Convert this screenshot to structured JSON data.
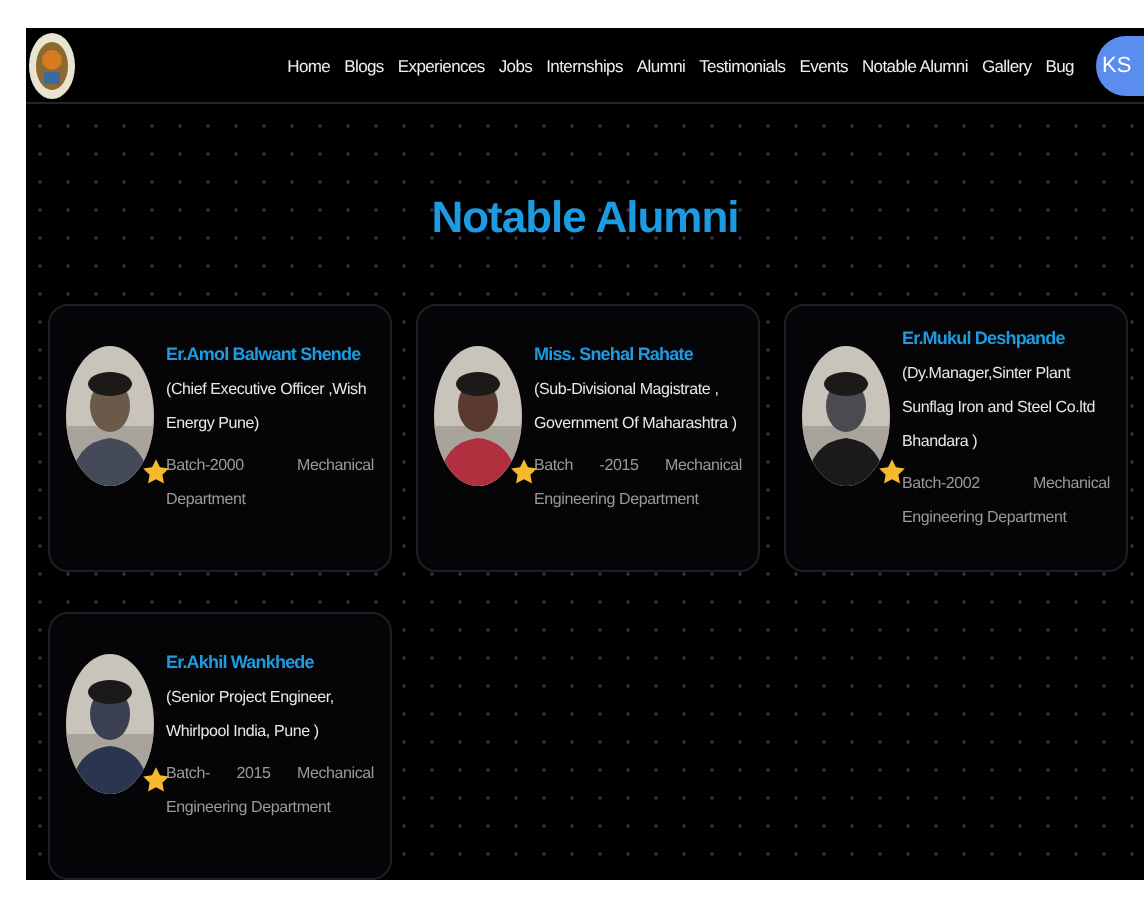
{
  "nav": {
    "items": [
      "Home",
      "Blogs",
      "Experiences",
      "Jobs",
      "Internships",
      "Alumni",
      "Testimonials",
      "Events",
      "Notable Alumni",
      "Gallery",
      "Bug"
    ],
    "avatar": "KS"
  },
  "heading": "Notable Alumni",
  "alumni": [
    {
      "name": "Er.Amol Balwant Shende",
      "role": "(Chief Executive Officer ,Wish Energy Pune)",
      "batch": "Batch-2000 Mechanical Department"
    },
    {
      "name": "Miss. Snehal Rahate",
      "role": "(Sub-Divisional Magistrate , Government Of Maharashtra )",
      "batch": "Batch -2015 Mechanical Engineering Department"
    },
    {
      "name": "Er.Mukul Deshpande",
      "role": "(Dy.Manager,Sinter Plant Sunflag Iron and Steel Co.ltd Bhandara )",
      "batch": "Batch-2002 Mechanical Engineering Department"
    },
    {
      "name": "Er.Akhil Wankhede",
      "role": "(Senior Project Engineer, Whirlpool India, Pune )",
      "batch": "Batch- 2015 Mechanical Engineering Department"
    }
  ]
}
